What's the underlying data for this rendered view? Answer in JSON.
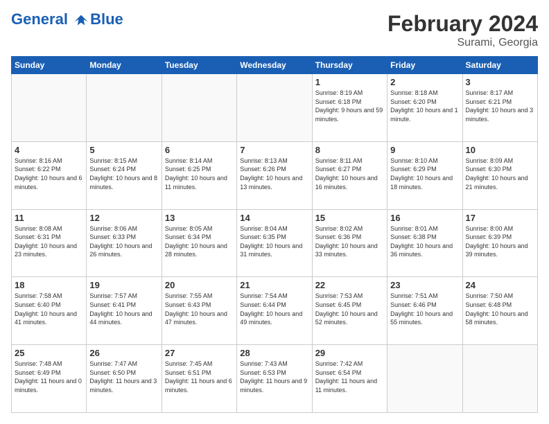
{
  "logo": {
    "line1": "General",
    "line2": "Blue"
  },
  "header": {
    "month": "February 2024",
    "location": "Surami, Georgia"
  },
  "weekdays": [
    "Sunday",
    "Monday",
    "Tuesday",
    "Wednesday",
    "Thursday",
    "Friday",
    "Saturday"
  ],
  "weeks": [
    [
      {
        "day": "",
        "info": ""
      },
      {
        "day": "",
        "info": ""
      },
      {
        "day": "",
        "info": ""
      },
      {
        "day": "",
        "info": ""
      },
      {
        "day": "1",
        "info": "Sunrise: 8:19 AM\nSunset: 6:18 PM\nDaylight: 9 hours and 59 minutes."
      },
      {
        "day": "2",
        "info": "Sunrise: 8:18 AM\nSunset: 6:20 PM\nDaylight: 10 hours and 1 minute."
      },
      {
        "day": "3",
        "info": "Sunrise: 8:17 AM\nSunset: 6:21 PM\nDaylight: 10 hours and 3 minutes."
      }
    ],
    [
      {
        "day": "4",
        "info": "Sunrise: 8:16 AM\nSunset: 6:22 PM\nDaylight: 10 hours and 6 minutes."
      },
      {
        "day": "5",
        "info": "Sunrise: 8:15 AM\nSunset: 6:24 PM\nDaylight: 10 hours and 8 minutes."
      },
      {
        "day": "6",
        "info": "Sunrise: 8:14 AM\nSunset: 6:25 PM\nDaylight: 10 hours and 11 minutes."
      },
      {
        "day": "7",
        "info": "Sunrise: 8:13 AM\nSunset: 6:26 PM\nDaylight: 10 hours and 13 minutes."
      },
      {
        "day": "8",
        "info": "Sunrise: 8:11 AM\nSunset: 6:27 PM\nDaylight: 10 hours and 16 minutes."
      },
      {
        "day": "9",
        "info": "Sunrise: 8:10 AM\nSunset: 6:29 PM\nDaylight: 10 hours and 18 minutes."
      },
      {
        "day": "10",
        "info": "Sunrise: 8:09 AM\nSunset: 6:30 PM\nDaylight: 10 hours and 21 minutes."
      }
    ],
    [
      {
        "day": "11",
        "info": "Sunrise: 8:08 AM\nSunset: 6:31 PM\nDaylight: 10 hours and 23 minutes."
      },
      {
        "day": "12",
        "info": "Sunrise: 8:06 AM\nSunset: 6:33 PM\nDaylight: 10 hours and 26 minutes."
      },
      {
        "day": "13",
        "info": "Sunrise: 8:05 AM\nSunset: 6:34 PM\nDaylight: 10 hours and 28 minutes."
      },
      {
        "day": "14",
        "info": "Sunrise: 8:04 AM\nSunset: 6:35 PM\nDaylight: 10 hours and 31 minutes."
      },
      {
        "day": "15",
        "info": "Sunrise: 8:02 AM\nSunset: 6:36 PM\nDaylight: 10 hours and 33 minutes."
      },
      {
        "day": "16",
        "info": "Sunrise: 8:01 AM\nSunset: 6:38 PM\nDaylight: 10 hours and 36 minutes."
      },
      {
        "day": "17",
        "info": "Sunrise: 8:00 AM\nSunset: 6:39 PM\nDaylight: 10 hours and 39 minutes."
      }
    ],
    [
      {
        "day": "18",
        "info": "Sunrise: 7:58 AM\nSunset: 6:40 PM\nDaylight: 10 hours and 41 minutes."
      },
      {
        "day": "19",
        "info": "Sunrise: 7:57 AM\nSunset: 6:41 PM\nDaylight: 10 hours and 44 minutes."
      },
      {
        "day": "20",
        "info": "Sunrise: 7:55 AM\nSunset: 6:43 PM\nDaylight: 10 hours and 47 minutes."
      },
      {
        "day": "21",
        "info": "Sunrise: 7:54 AM\nSunset: 6:44 PM\nDaylight: 10 hours and 49 minutes."
      },
      {
        "day": "22",
        "info": "Sunrise: 7:53 AM\nSunset: 6:45 PM\nDaylight: 10 hours and 52 minutes."
      },
      {
        "day": "23",
        "info": "Sunrise: 7:51 AM\nSunset: 6:46 PM\nDaylight: 10 hours and 55 minutes."
      },
      {
        "day": "24",
        "info": "Sunrise: 7:50 AM\nSunset: 6:48 PM\nDaylight: 10 hours and 58 minutes."
      }
    ],
    [
      {
        "day": "25",
        "info": "Sunrise: 7:48 AM\nSunset: 6:49 PM\nDaylight: 11 hours and 0 minutes."
      },
      {
        "day": "26",
        "info": "Sunrise: 7:47 AM\nSunset: 6:50 PM\nDaylight: 11 hours and 3 minutes."
      },
      {
        "day": "27",
        "info": "Sunrise: 7:45 AM\nSunset: 6:51 PM\nDaylight: 11 hours and 6 minutes."
      },
      {
        "day": "28",
        "info": "Sunrise: 7:43 AM\nSunset: 6:53 PM\nDaylight: 11 hours and 9 minutes."
      },
      {
        "day": "29",
        "info": "Sunrise: 7:42 AM\nSunset: 6:54 PM\nDaylight: 11 hours and 11 minutes."
      },
      {
        "day": "",
        "info": ""
      },
      {
        "day": "",
        "info": ""
      }
    ]
  ]
}
